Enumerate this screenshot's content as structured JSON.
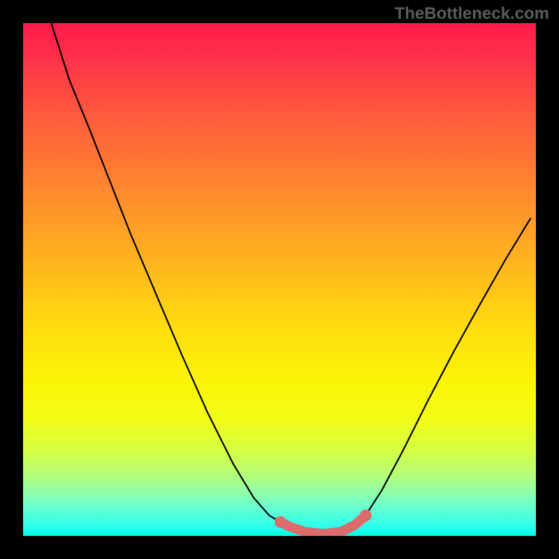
{
  "watermark": "TheBottleneck.com",
  "chart_data": {
    "type": "line",
    "title": "",
    "xlabel": "",
    "ylabel": "",
    "xlim": [
      0,
      1
    ],
    "ylim": [
      0,
      1
    ],
    "series": [
      {
        "name": "curve",
        "color": "#000000",
        "points": [
          {
            "x": 0.055,
            "y": 1.0
          },
          {
            "x": 0.09,
            "y": 0.89
          },
          {
            "x": 0.13,
            "y": 0.792
          },
          {
            "x": 0.17,
            "y": 0.69
          },
          {
            "x": 0.21,
            "y": 0.588
          },
          {
            "x": 0.26,
            "y": 0.47
          },
          {
            "x": 0.31,
            "y": 0.352
          },
          {
            "x": 0.36,
            "y": 0.24
          },
          {
            "x": 0.41,
            "y": 0.14
          },
          {
            "x": 0.45,
            "y": 0.074
          },
          {
            "x": 0.48,
            "y": 0.04
          },
          {
            "x": 0.502,
            "y": 0.027
          },
          {
            "x": 0.52,
            "y": 0.018
          },
          {
            "x": 0.55,
            "y": 0.008
          },
          {
            "x": 0.585,
            "y": 0.004
          },
          {
            "x": 0.62,
            "y": 0.008
          },
          {
            "x": 0.648,
            "y": 0.022
          },
          {
            "x": 0.668,
            "y": 0.04
          },
          {
            "x": 0.7,
            "y": 0.09
          },
          {
            "x": 0.74,
            "y": 0.165
          },
          {
            "x": 0.79,
            "y": 0.265
          },
          {
            "x": 0.84,
            "y": 0.36
          },
          {
            "x": 0.89,
            "y": 0.45
          },
          {
            "x": 0.94,
            "y": 0.538
          },
          {
            "x": 0.99,
            "y": 0.62
          }
        ]
      },
      {
        "name": "highlight",
        "color": "#e06666",
        "points": [
          {
            "x": 0.502,
            "y": 0.027
          },
          {
            "x": 0.52,
            "y": 0.018
          },
          {
            "x": 0.55,
            "y": 0.008
          },
          {
            "x": 0.585,
            "y": 0.004
          },
          {
            "x": 0.62,
            "y": 0.008
          },
          {
            "x": 0.648,
            "y": 0.022
          },
          {
            "x": 0.668,
            "y": 0.04
          }
        ]
      }
    ],
    "gradient_stops": [
      {
        "pos": 0.0,
        "color": "#ff1a4d"
      },
      {
        "pos": 0.18,
        "color": "#ff5a3e"
      },
      {
        "pos": 0.47,
        "color": "#ffb61f"
      },
      {
        "pos": 0.7,
        "color": "#fbf506"
      },
      {
        "pos": 0.88,
        "color": "#b4ff78"
      },
      {
        "pos": 1.0,
        "color": "#00ffd8"
      }
    ]
  }
}
